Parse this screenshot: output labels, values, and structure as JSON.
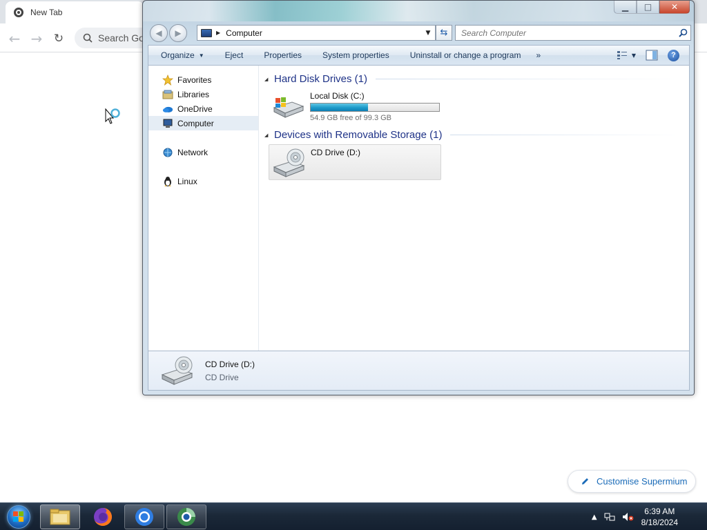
{
  "browser": {
    "tab_title": "New Tab",
    "omnibox_placeholder": "Search Go",
    "customise_label": "Customise Supermium"
  },
  "explorer": {
    "address_location": "Computer",
    "search_placeholder": "Search Computer",
    "commands": {
      "organize": "Organize",
      "eject": "Eject",
      "properties": "Properties",
      "system_properties": "System properties",
      "uninstall": "Uninstall or change a program",
      "more": "»"
    },
    "navpane": {
      "favorites": "Favorites",
      "libraries": "Libraries",
      "onedrive": "OneDrive",
      "computer": "Computer",
      "network": "Network",
      "linux": "Linux"
    },
    "groups": {
      "hard_disks": "Hard Disk Drives (1)",
      "removable": "Devices with Removable Storage (1)"
    },
    "local_disk": {
      "name": "Local Disk (C:)",
      "free_text": "54.9 GB free of 99.3 GB",
      "used_fraction": 0.447
    },
    "cd_drive": {
      "name": "CD Drive (D:)"
    },
    "details": {
      "name": "CD Drive (D:)",
      "type": "CD Drive"
    }
  },
  "taskbar": {
    "time": "6:39 AM",
    "date": "8/18/2024",
    "icons": [
      "start-orb",
      "file-explorer",
      "firefox",
      "chromium",
      "supermium"
    ]
  },
  "colors": {
    "group_header": "#1e3287",
    "command_text": "#1e395b",
    "bar_fill": "#1c9ac9",
    "link_blue": "#1a6bb8"
  }
}
